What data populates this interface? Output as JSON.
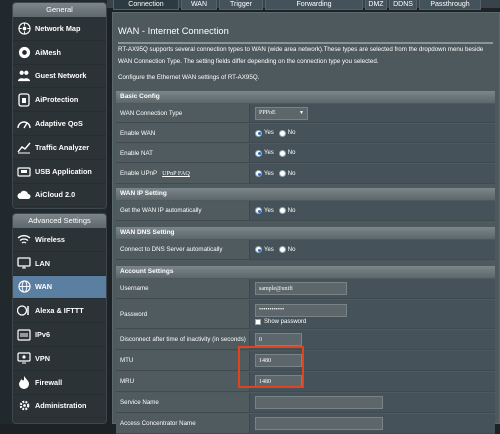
{
  "tabs": [
    "Connection",
    "WAN",
    "Trigger",
    "Forwarding",
    "DMZ",
    "DDNS",
    "Passthrough"
  ],
  "active_tab": 0,
  "general": {
    "header": "General",
    "items": [
      {
        "label": "Network Map",
        "icon": "network-map-icon"
      },
      {
        "label": "AiMesh",
        "icon": "aimesh-icon"
      },
      {
        "label": "Guest Network",
        "icon": "guest-network-icon"
      },
      {
        "label": "AiProtection",
        "icon": "shield-icon"
      },
      {
        "label": "Adaptive QoS",
        "icon": "qos-gauge-icon"
      },
      {
        "label": "Traffic Analyzer",
        "icon": "traffic-chart-icon"
      },
      {
        "label": "USB Application",
        "icon": "usb-icon"
      },
      {
        "label": "AiCloud 2.0",
        "icon": "cloud-icon"
      }
    ]
  },
  "advanced": {
    "header": "Advanced Settings",
    "items": [
      {
        "label": "Wireless",
        "icon": "wifi-icon"
      },
      {
        "label": "LAN",
        "icon": "lan-icon"
      },
      {
        "label": "WAN",
        "icon": "globe-icon",
        "active": true
      },
      {
        "label": "Alexa & IFTTT",
        "icon": "alexa-icon"
      },
      {
        "label": "IPv6",
        "icon": "ipv6-icon"
      },
      {
        "label": "VPN",
        "icon": "vpn-icon"
      },
      {
        "label": "Firewall",
        "icon": "firewall-icon"
      },
      {
        "label": "Administration",
        "icon": "admin-icon"
      }
    ]
  },
  "main": {
    "title": "WAN - Internet Connection",
    "desc1": "RT-AX95Q supports several connection types to WAN (wide area network).These types are selected from the dropdown menu beside WAN Connection Type. The setting fields differ depending on the connection type you selected.",
    "desc2": "Configure the Ethernet WAN settings of RT-AX95Q.",
    "basic": {
      "header": "Basic Config",
      "conn_type_label": "WAN Connection Type",
      "conn_type_value": "PPPoE",
      "enable_wan_label": "Enable WAN",
      "enable_nat_label": "Enable NAT",
      "enable_upnp_label": "Enable UPnP",
      "upnp_faq": "UPnP FAQ"
    },
    "ip": {
      "header": "WAN IP Setting",
      "auto_label": "Get the WAN IP automatically"
    },
    "dns": {
      "header": "WAN DNS Setting",
      "auto_label": "Connect to DNS Server automatically"
    },
    "account": {
      "header": "Account Settings",
      "username_label": "Username",
      "username_value": "sample@unifi",
      "password_label": "Password",
      "password_value": "••••••••••••",
      "show_password": "Show password",
      "idle_label": "Disconnect after time of inactivity (in seconds)",
      "idle_value": "0",
      "mtu_label": "MTU",
      "mtu_value": "1480",
      "mru_label": "MRU",
      "mru_value": "1480",
      "service_label": "Service Name",
      "service_value": "",
      "ac_label": "Access Concentrator Name",
      "ac_value": ""
    },
    "yes": "Yes",
    "no": "No"
  }
}
